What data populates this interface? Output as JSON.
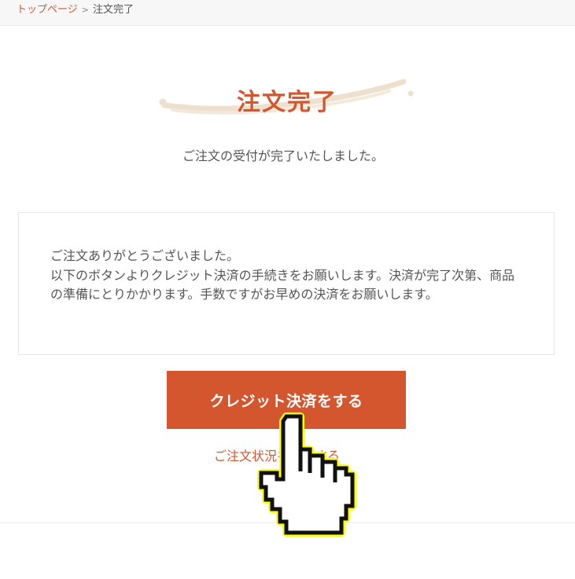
{
  "breadcrumb": {
    "home": "トップページ",
    "separator": ">",
    "current": "注文完了"
  },
  "page": {
    "title": "注文完了",
    "subtitle": "ご注文の受付が完了いたしました。"
  },
  "message": {
    "text": "ご注文ありがとうございました。\n以下のボタンよりクレジット決済の手続きをお願いします。決済が完了次第、商品の準備にとりかかります。手数ですがお早めの決済をお願いします。"
  },
  "actions": {
    "pay_button_label": "クレジット決済をする",
    "status_link_label": "ご注文状況を確認する"
  },
  "colors": {
    "accent": "#d4562f",
    "swoosh": "#f0e2cc",
    "cursor_highlight": "#ffff00"
  },
  "icons": {
    "cursor": "hand-pointer-icon"
  }
}
